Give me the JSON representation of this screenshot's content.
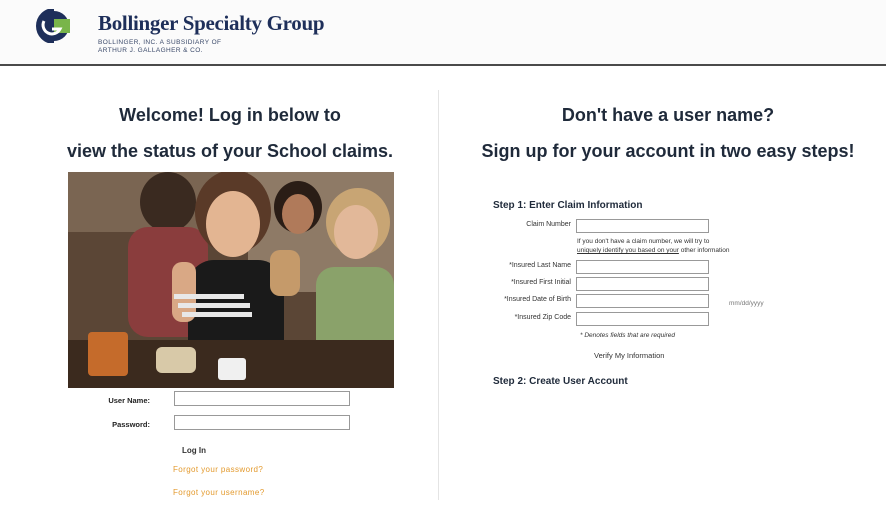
{
  "header": {
    "brand": "Bollinger Specialty Group",
    "sub_line1": "BOLLINGER, INC. A SUBSIDIARY OF",
    "sub_line2": "ARTHUR J. GALLAGHER & CO."
  },
  "login": {
    "title_line1": "Welcome! Log in below to",
    "title_line2": "view the status of your School claims.",
    "photo_icon": "students-photo",
    "username_label": "User Name:",
    "username_value": "",
    "password_label": "Password:",
    "password_value": "",
    "login_button": "Log In",
    "forgot_password": "Forgot your password?",
    "forgot_username": "Forgot your username?"
  },
  "signup": {
    "title_line1": "Don't have a user name?",
    "title_line2": "Sign up for your account in two easy steps!",
    "step1": "Step 1: Enter Claim Information",
    "claim_number_label": "Claim Number",
    "hint_line1": "If you don't have a claim number, we will try to",
    "hint_line2_a": "uniquely identify you based on your",
    "hint_line2_b": " other information",
    "last_name_label": "*Insured Last Name",
    "first_initial_label": "*Insured First Initial",
    "dob_label": "*Insured Date of Birth",
    "dob_format": "mm/dd/yyyy",
    "zip_label": "*Insured Zip Code",
    "required_note": "* Denotes fields that are required",
    "verify_button": "Verify My Information",
    "step2": "Step 2: Create User Account"
  },
  "colors": {
    "brand_blue": "#1e2f5a",
    "link_orange": "#e39a2e",
    "logo_green": "#79b54a"
  }
}
